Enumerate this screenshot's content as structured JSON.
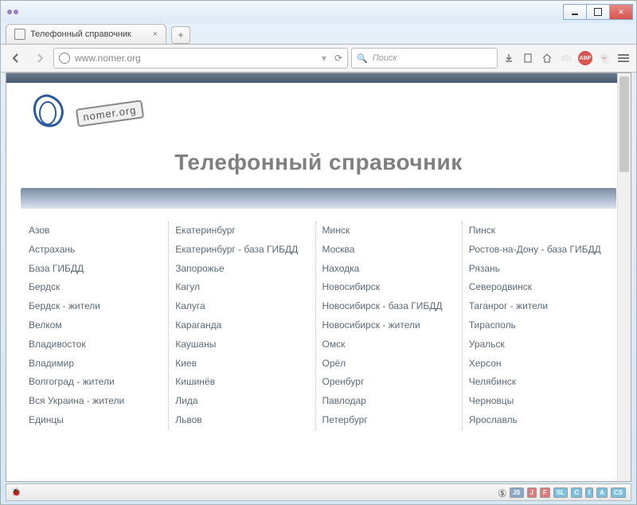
{
  "window": {
    "tab_title": "Телефонный справочник"
  },
  "toolbar": {
    "url": "www.nomer.org",
    "search_placeholder": "Поиск",
    "abp_label": "ABP"
  },
  "page": {
    "logo_text": "nomer.org",
    "title": "Телефонный справочник"
  },
  "cities": {
    "col1": [
      "Азов",
      "Астрахань",
      "База ГИБДД",
      "Бердск",
      "Бердск - жители",
      "Велком",
      "Владивосток",
      "Владимир",
      "Волгоград - жители",
      "Вся Украина - жители",
      "Единцы"
    ],
    "col2": [
      "Екатеринбург",
      "Екатеринбург - база ГИБДД",
      "Запорожье",
      "Кагул",
      "Калуга",
      "Караганда",
      "Каушаны",
      "Киев",
      "Кишинёв",
      "Лида",
      "Львов"
    ],
    "col3": [
      "Минск",
      "Москва",
      "Находка",
      "Новосибирск",
      "Новосибирск - база ГИБДД",
      "Новосибирск - жители",
      "Омск",
      "Орёл",
      "Оренбург",
      "Павлодар",
      "Петербург"
    ],
    "col4": [
      "Пинск",
      "Ростов-на-Дону - база ГИБДД",
      "Рязань",
      "Северодвинск",
      "Таганрог - жители",
      "Тирасполь",
      "Уральск",
      "Херсон",
      "Челябинск",
      "Черновцы",
      "Ярославль"
    ]
  },
  "status": {
    "badges": [
      "JS",
      "J",
      "F",
      "SL",
      "C",
      "I",
      "A",
      "CS"
    ]
  }
}
